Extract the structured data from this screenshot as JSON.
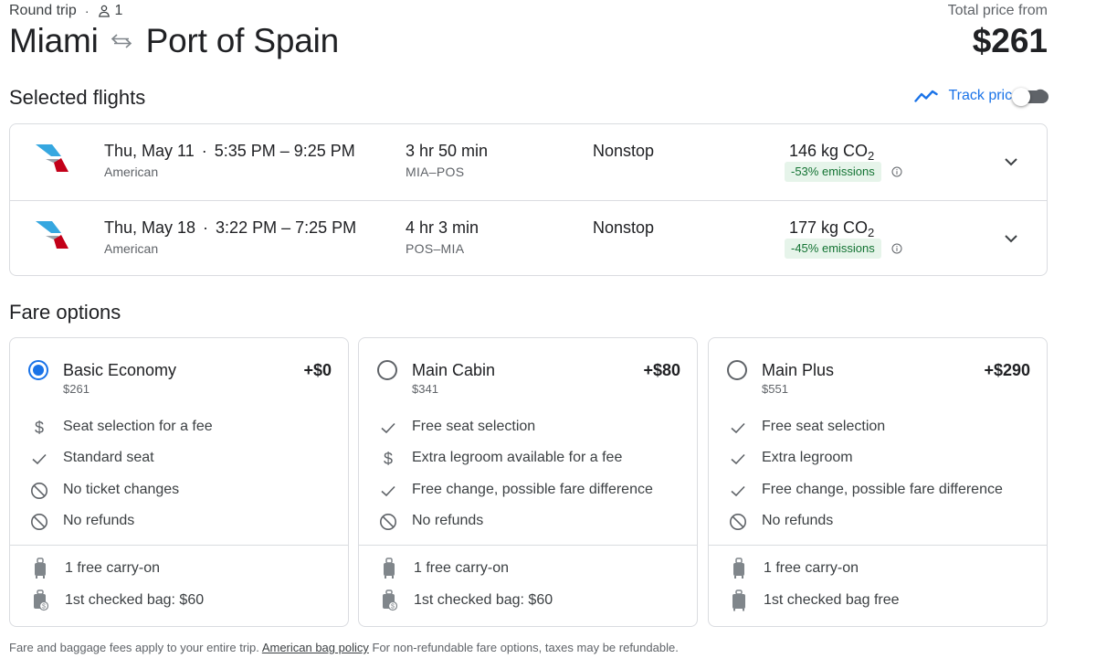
{
  "header": {
    "trip_type": "Round trip",
    "passengers": "1",
    "origin": "Miami",
    "destination": "Port of Spain",
    "total_label": "Total price from",
    "total_price": "$261"
  },
  "selected_flights": {
    "title": "Selected flights",
    "track_label": "Track prices",
    "track_enabled": false,
    "flights": [
      {
        "date": "Thu, May 11",
        "times": "5:35 PM – 9:25 PM",
        "airline": "American",
        "duration": "3 hr 50 min",
        "route": "MIA–POS",
        "stops": "Nonstop",
        "co2_value": "146 kg CO",
        "co2_sub": "2",
        "emissions": "-53% emissions"
      },
      {
        "date": "Thu, May 18",
        "times": "3:22 PM – 7:25 PM",
        "airline": "American",
        "duration": "4 hr 3 min",
        "route": "POS–MIA",
        "stops": "Nonstop",
        "co2_value": "177 kg CO",
        "co2_sub": "2",
        "emissions": "-45% emissions"
      }
    ]
  },
  "fare_options": {
    "title": "Fare options",
    "cards": [
      {
        "name": "Basic Economy",
        "base_price": "$261",
        "delta": "+$0",
        "selected": true,
        "features": [
          {
            "icon": "dollar-icon",
            "text": "Seat selection for a fee"
          },
          {
            "icon": "check-icon",
            "text": "Standard seat"
          },
          {
            "icon": "block-icon",
            "text": "No ticket changes"
          },
          {
            "icon": "block-icon",
            "text": "No refunds"
          }
        ],
        "bags": [
          {
            "icon": "carry-on-icon",
            "text": "1 free carry-on"
          },
          {
            "icon": "checked-bag-fee-icon",
            "text": "1st checked bag: $60"
          }
        ]
      },
      {
        "name": "Main Cabin",
        "base_price": "$341",
        "delta": "+$80",
        "selected": false,
        "features": [
          {
            "icon": "check-icon",
            "text": "Free seat selection"
          },
          {
            "icon": "dollar-icon",
            "text": "Extra legroom available for a fee"
          },
          {
            "icon": "check-icon",
            "text": "Free change, possible fare difference"
          },
          {
            "icon": "block-icon",
            "text": "No refunds"
          }
        ],
        "bags": [
          {
            "icon": "carry-on-icon",
            "text": "1 free carry-on"
          },
          {
            "icon": "checked-bag-fee-icon",
            "text": "1st checked bag: $60"
          }
        ]
      },
      {
        "name": "Main Plus",
        "base_price": "$551",
        "delta": "+$290",
        "selected": false,
        "features": [
          {
            "icon": "check-icon",
            "text": "Free seat selection"
          },
          {
            "icon": "check-icon",
            "text": "Extra legroom"
          },
          {
            "icon": "check-icon",
            "text": "Free change, possible fare difference"
          },
          {
            "icon": "block-icon",
            "text": "No refunds"
          }
        ],
        "bags": [
          {
            "icon": "carry-on-icon",
            "text": "1 free carry-on"
          },
          {
            "icon": "checked-bag-icon",
            "text": "1st checked bag free"
          }
        ]
      }
    ]
  },
  "footer": {
    "text_before": "Fare and baggage fees apply to your entire trip.",
    "link": "American bag policy",
    "text_after": "For non-refundable fare options, taxes may be refundable."
  },
  "colors": {
    "accent": "#1a73e8",
    "emissions_text": "#137333",
    "emissions_bg": "#e6f4ea",
    "airline_red": "#c30019",
    "airline_blue": "#36a7e0"
  }
}
